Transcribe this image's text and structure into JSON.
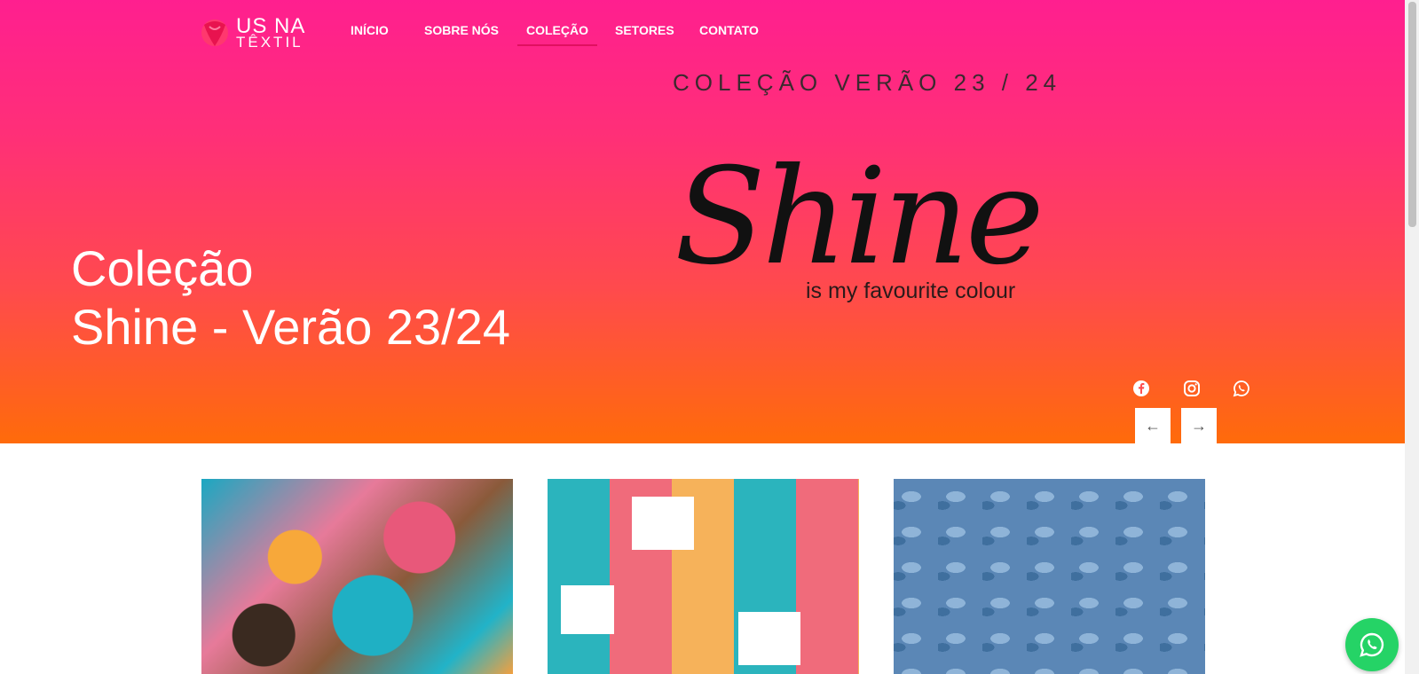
{
  "brand": {
    "line1": "US NA",
    "line2": "TÊXTIL",
    "accent": "#ff2f78"
  },
  "nav": {
    "items": [
      {
        "label": "INÍCIO"
      },
      {
        "label": "SOBRE NÓS"
      },
      {
        "label": "COLEÇÃO",
        "active": true
      },
      {
        "label": "SETORES"
      },
      {
        "label": "CONTATO"
      }
    ]
  },
  "hero": {
    "subtitle": "COLEÇÃO VERÃO 23 / 24",
    "script_title": "Shine",
    "tagline": "is my favourite colour",
    "heading_line1": "Coleção",
    "heading_line2": "Shine - Verão 23/24",
    "prev_icon": "arrow-left-icon",
    "next_icon": "arrow-right-icon",
    "prev_glyph": "←",
    "next_glyph": "→"
  },
  "social": [
    {
      "icon": "facebook-icon"
    },
    {
      "icon": "instagram-icon"
    },
    {
      "icon": "whatsapp-icon"
    }
  ],
  "gallery": [
    {
      "icon": "butterfly-print-image"
    },
    {
      "icon": "pineapple-patchwork-print-image"
    },
    {
      "icon": "denim-leopard-print-image"
    }
  ],
  "whatsapp_button": {
    "icon": "whatsapp-icon",
    "color": "#25d366"
  }
}
